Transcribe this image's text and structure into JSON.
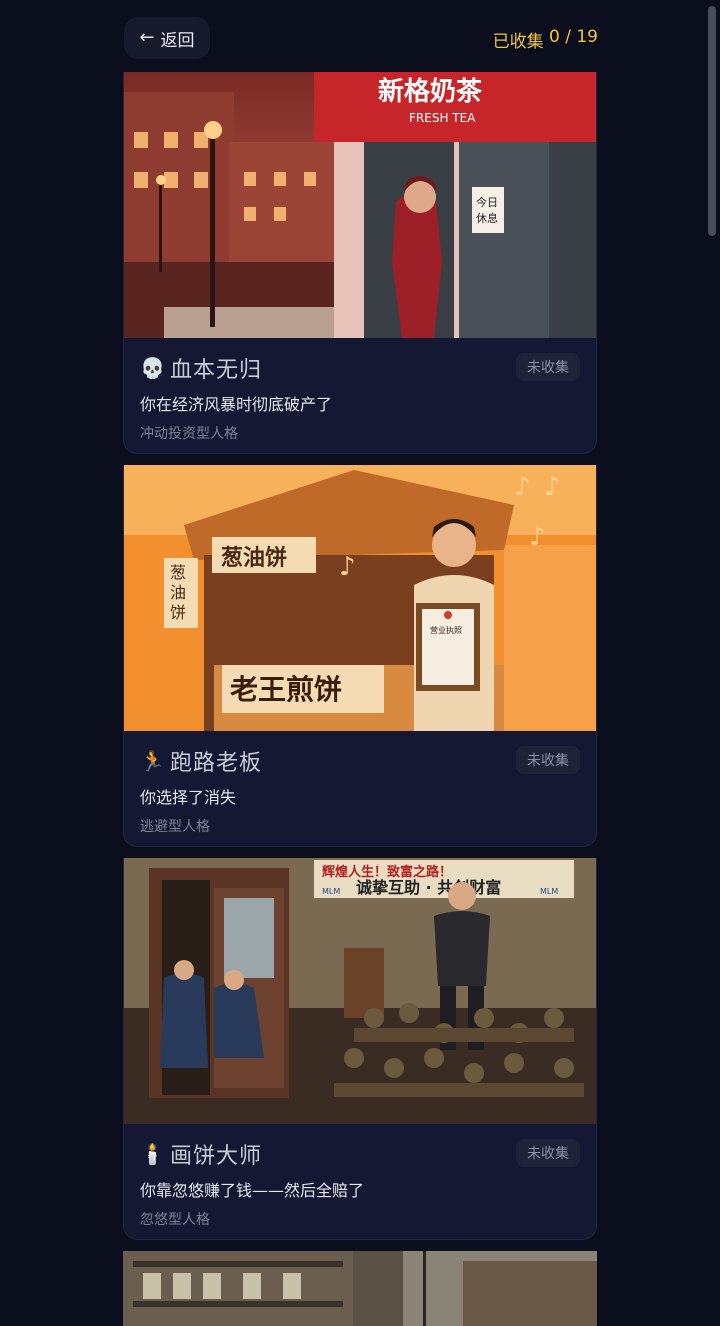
{
  "header": {
    "back_label": "返回",
    "collected_prefix": "已收集",
    "collected_count": "0 / 19"
  },
  "cards": [
    {
      "emoji": "💀",
      "title": "血本无归",
      "description": "你在经济风暴时彻底破产了",
      "type": "冲动投资型人格",
      "badge": "未收集",
      "image_texts": [
        "新格奶茶",
        "FRESH TEA",
        "今日",
        "休息"
      ]
    },
    {
      "emoji": "🏃",
      "title": "跑路老板",
      "description": "你选择了消失",
      "type": "逃避型人格",
      "badge": "未收集",
      "image_texts": [
        "葱油饼",
        "葱油饼",
        "老王煎饼",
        "营业执照"
      ]
    },
    {
      "emoji": "🕯️",
      "title": "画饼大师",
      "description": "你靠忽悠赚了钱——然后全赔了",
      "type": "忽悠型人格",
      "badge": "未收集",
      "image_texts": [
        "辉煌人生！致富之路！",
        "诚挚互助 · 共创财富",
        "MLM",
        "MLM"
      ]
    }
  ],
  "colors": {
    "background": "#0b0e1c",
    "card": "#141832",
    "accent_counter": "#f4c542",
    "badge_bg": "#1f2338"
  }
}
